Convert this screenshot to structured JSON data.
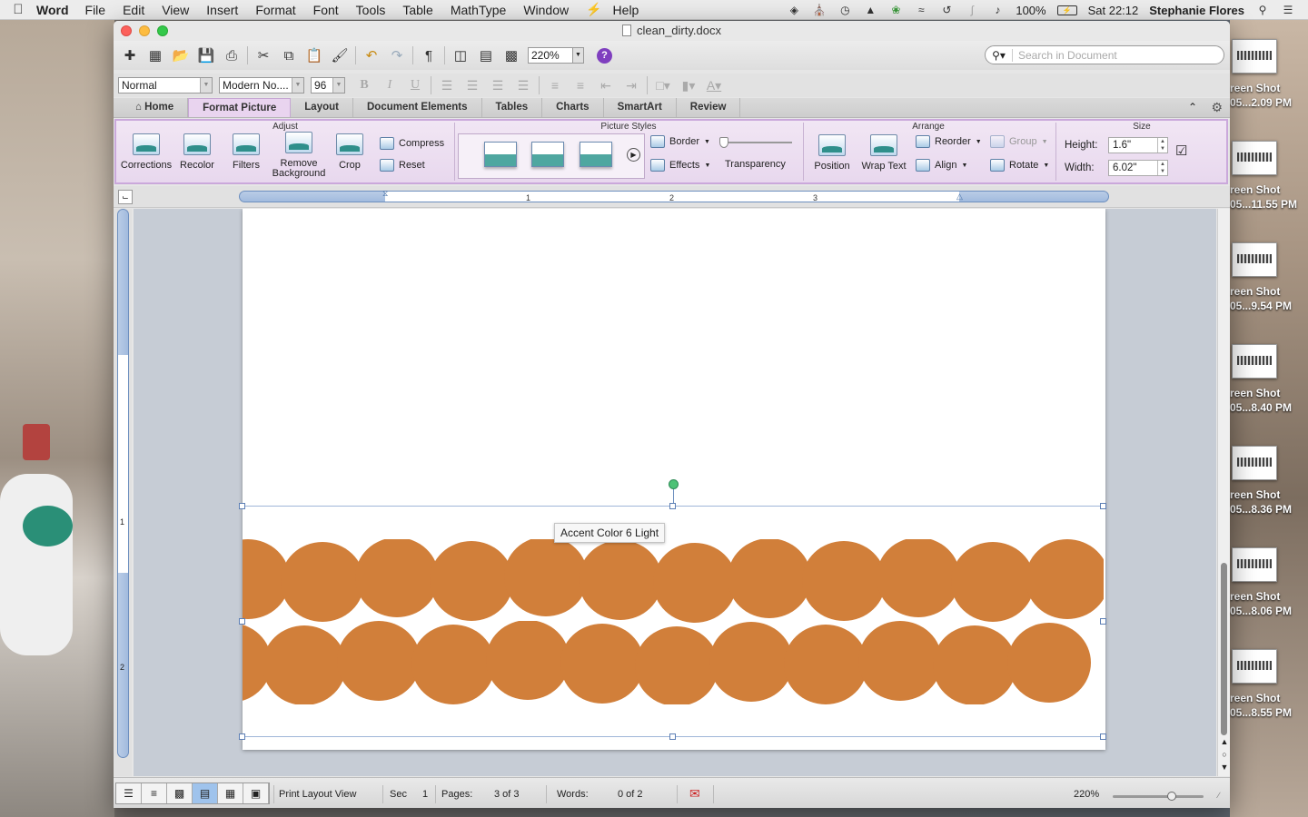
{
  "menubar": {
    "app": "Word",
    "items": [
      "File",
      "Edit",
      "View",
      "Insert",
      "Format",
      "Font",
      "Tools",
      "Table",
      "MathType",
      "Window",
      "Help"
    ],
    "battery": "100%",
    "clock": "Sat 22:12",
    "user": "Stephanie Flores"
  },
  "desktop_icons": [
    {
      "line1": "reen Shot",
      "line2": "05...2.09 PM"
    },
    {
      "line1": "reen Shot",
      "line2": "05...11.55 PM"
    },
    {
      "line1": "reen Shot",
      "line2": "05...9.54 PM"
    },
    {
      "line1": "reen Shot",
      "line2": "05...8.40 PM"
    },
    {
      "line1": "reen Shot",
      "line2": "05...8.36 PM"
    },
    {
      "line1": "reen Shot",
      "line2": "05...8.06 PM"
    },
    {
      "line1": "reen Shot",
      "line2": "05...8.55 PM"
    }
  ],
  "window": {
    "title": "clean_dirty.docx",
    "zoom": "220%",
    "search_placeholder": "Search in Document"
  },
  "format_toolbar": {
    "style": "Normal",
    "font": "Modern No....",
    "size": "96"
  },
  "ribbon_tabs": [
    "Home",
    "Format Picture",
    "Layout",
    "Document Elements",
    "Tables",
    "Charts",
    "SmartArt",
    "Review"
  ],
  "ribbon": {
    "groups": {
      "adjust": "Adjust",
      "picture_styles": "Picture Styles",
      "arrange": "Arrange",
      "size": "Size"
    },
    "buttons": {
      "corrections": "Corrections",
      "recolor": "Recolor",
      "filters": "Filters",
      "remove_bg_1": "Remove",
      "remove_bg_2": "Background",
      "crop": "Crop",
      "compress": "Compress",
      "reset": "Reset",
      "border": "Border",
      "effects": "Effects",
      "transparency": "Transparency",
      "position": "Position",
      "wrap_text": "Wrap Text",
      "reorder": "Reorder",
      "align": "Align",
      "group": "Group",
      "rotate": "Rotate"
    },
    "size": {
      "height_label": "Height:",
      "height_value": "1.6\"",
      "width_label": "Width:",
      "width_value": "6.02\""
    }
  },
  "ruler": {
    "marks": [
      "1",
      "2",
      "3"
    ]
  },
  "vruler": {
    "marks": [
      "1",
      "2"
    ]
  },
  "document": {
    "tooltip": "Accent Color 6 Light",
    "picture_color": "#d17f3a"
  },
  "statusbar": {
    "view_label": "Print Layout View",
    "sec_label": "Sec",
    "sec_value": "1",
    "pages_label": "Pages:",
    "pages_value": "3 of 3",
    "words_label": "Words:",
    "words_value": "0 of 2",
    "zoom": "220%"
  }
}
